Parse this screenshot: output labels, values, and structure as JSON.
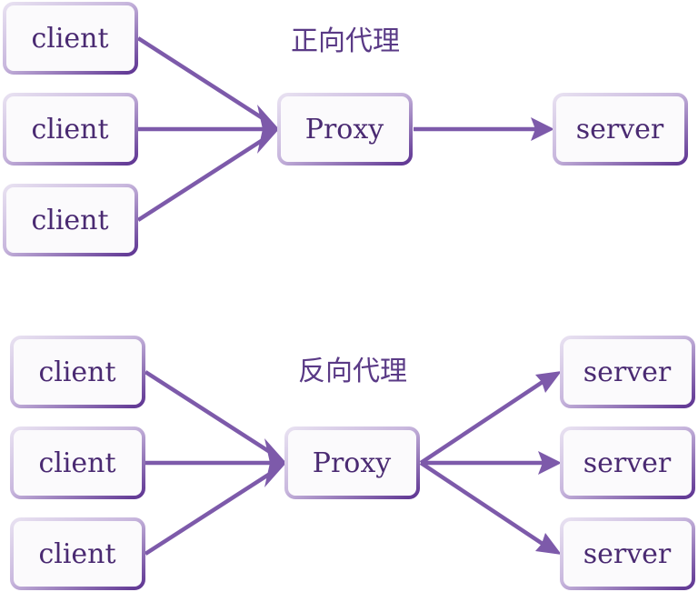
{
  "forward": {
    "title": "正向代理",
    "clients": [
      "client",
      "client",
      "client"
    ],
    "proxy": "Proxy",
    "servers": [
      "server"
    ]
  },
  "reverse": {
    "title": "反向代理",
    "clients": [
      "client",
      "client",
      "client"
    ],
    "proxy": "Proxy",
    "servers": [
      "server",
      "server",
      "server"
    ]
  },
  "colors": {
    "border_dark": "#6a3f9a",
    "border_light": "#e4dcee",
    "arrow": "#7d5aaa",
    "text": "#4a2a72",
    "box_fill": "#fbfafc"
  }
}
